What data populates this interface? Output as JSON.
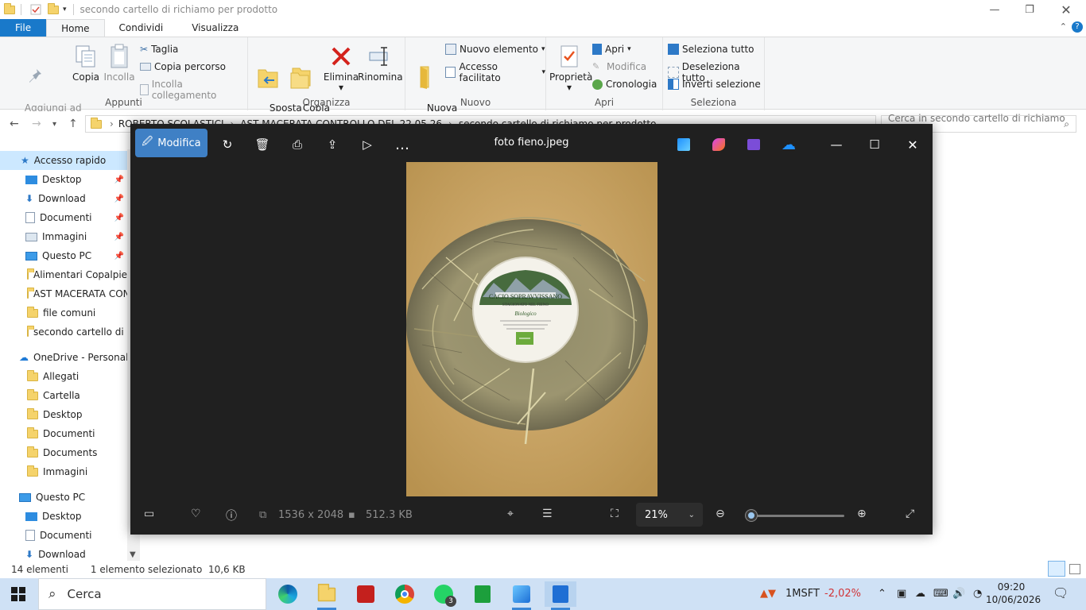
{
  "explorer": {
    "title": "secondo cartello di richiamo per prodotto",
    "tabs": [
      "File",
      "Home",
      "Condividi",
      "Visualizza"
    ],
    "ribbon": {
      "appunti": {
        "label": "Appunti",
        "pin": "Aggiungi ad\nAccesso rapido",
        "copy": "Copia",
        "paste": "Incolla",
        "cut": "Taglia",
        "copy_path": "Copia percorso",
        "paste_link": "Incolla collegamento"
      },
      "organizza": {
        "label": "Organizza",
        "move": "Sposta\nin",
        "copyto": "Copia\nin",
        "delete": "Elimina",
        "rename": "Rinomina"
      },
      "nuovo": {
        "label": "Nuovo",
        "new_folder": "Nuova\ncartella",
        "new_item": "Nuovo elemento",
        "easy_access": "Accesso facilitato"
      },
      "apri": {
        "label": "Apri",
        "properties": "Proprietà",
        "open": "Apri",
        "edit": "Modifica",
        "history": "Cronologia"
      },
      "seleziona": {
        "label": "Seleziona",
        "select_all": "Seleziona tutto",
        "deselect_all": "Deseleziona tutto",
        "invert": "Inverti selezione"
      }
    },
    "address": {
      "crumbs": [
        "ROBERTO SCOLASTICI",
        "AST MACERATA CONTROLLO DEL 22.05.26",
        "secondo cartello di richiamo per prodotto"
      ],
      "search_placeholder": "Cerca in secondo cartello di richiamo ..."
    },
    "nav": {
      "quick": "Accesso rapido",
      "quick_items": [
        "Desktop",
        "Download",
        "Documenti",
        "Immagini",
        "Questo PC",
        "Alimentari Copalpie",
        "AST MACERATA CON",
        "file comuni",
        "secondo cartello di r"
      ],
      "onedrive": "OneDrive - Personal",
      "onedrive_items": [
        "Allegati",
        "Cartella",
        "Desktop",
        "Documenti",
        "Documents",
        "Immagini"
      ],
      "thispc": "Questo PC",
      "thispc_items": [
        "Desktop",
        "Documenti",
        "Download"
      ]
    },
    "status": {
      "count": "14 elementi",
      "selection": "1 elemento selezionato  10,6 KB"
    }
  },
  "photos": {
    "edit_label": "Modifica",
    "filename": "foto fieno.jpeg",
    "dimensions": "1536 x 2048",
    "filesize": "512.3 KB",
    "zoom": "21%",
    "zoom_level": 0.02,
    "photo_label": {
      "title": "CACIO SOPRAVVISSANO",
      "subtitle": "STAGIONATO NEL FIENO",
      "organic": "Biologico"
    }
  },
  "taskbar": {
    "search": "Cerca",
    "whatsapp_badge": "3",
    "stock": {
      "symbol": "1MSFT",
      "change": "-2,02%"
    },
    "time": "09:20",
    "date": "10/06/2026"
  },
  "colors": {
    "accent": "#1979ca",
    "photos_bg": "#202020",
    "edit_btn": "#3f80c5",
    "stock_neg": "#d13438"
  }
}
